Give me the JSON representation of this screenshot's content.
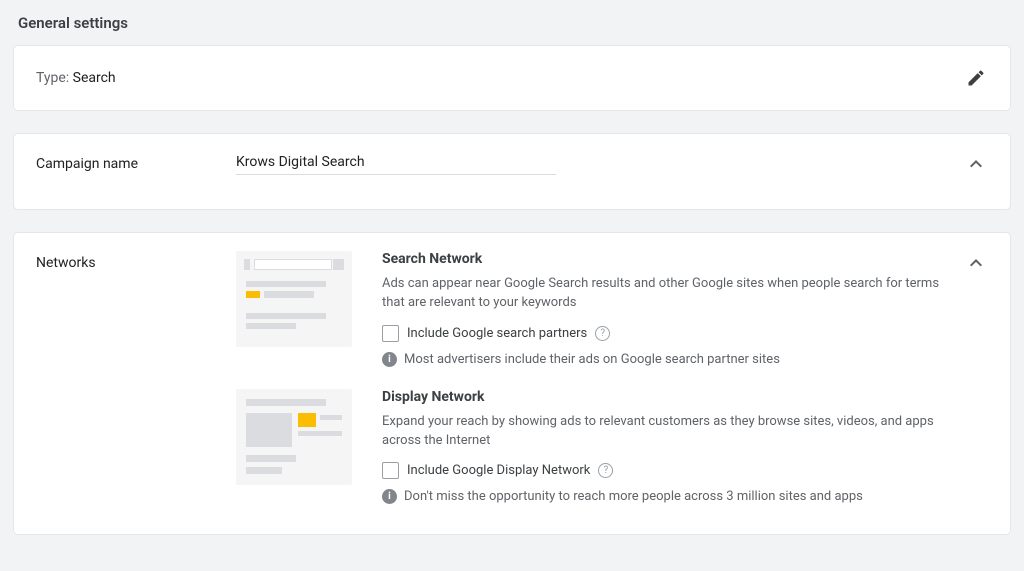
{
  "page_title": "General settings",
  "type_row": {
    "label": "Type: ",
    "value": "Search"
  },
  "campaign": {
    "label": "Campaign name",
    "value": "Krows Digital Search"
  },
  "networks": {
    "label": "Networks",
    "search": {
      "title": "Search Network",
      "desc": "Ads can appear near Google Search results and other Google sites when people search for terms that are relevant to your keywords",
      "checkbox_label": "Include Google search partners",
      "info": "Most advertisers include their ads on Google search partner sites"
    },
    "display": {
      "title": "Display Network",
      "desc": "Expand your reach by showing ads to relevant customers as they browse sites, videos, and apps across the Internet",
      "checkbox_label": "Include Google Display Network",
      "info": "Don't miss the opportunity to reach more people across 3 million sites and apps"
    }
  }
}
